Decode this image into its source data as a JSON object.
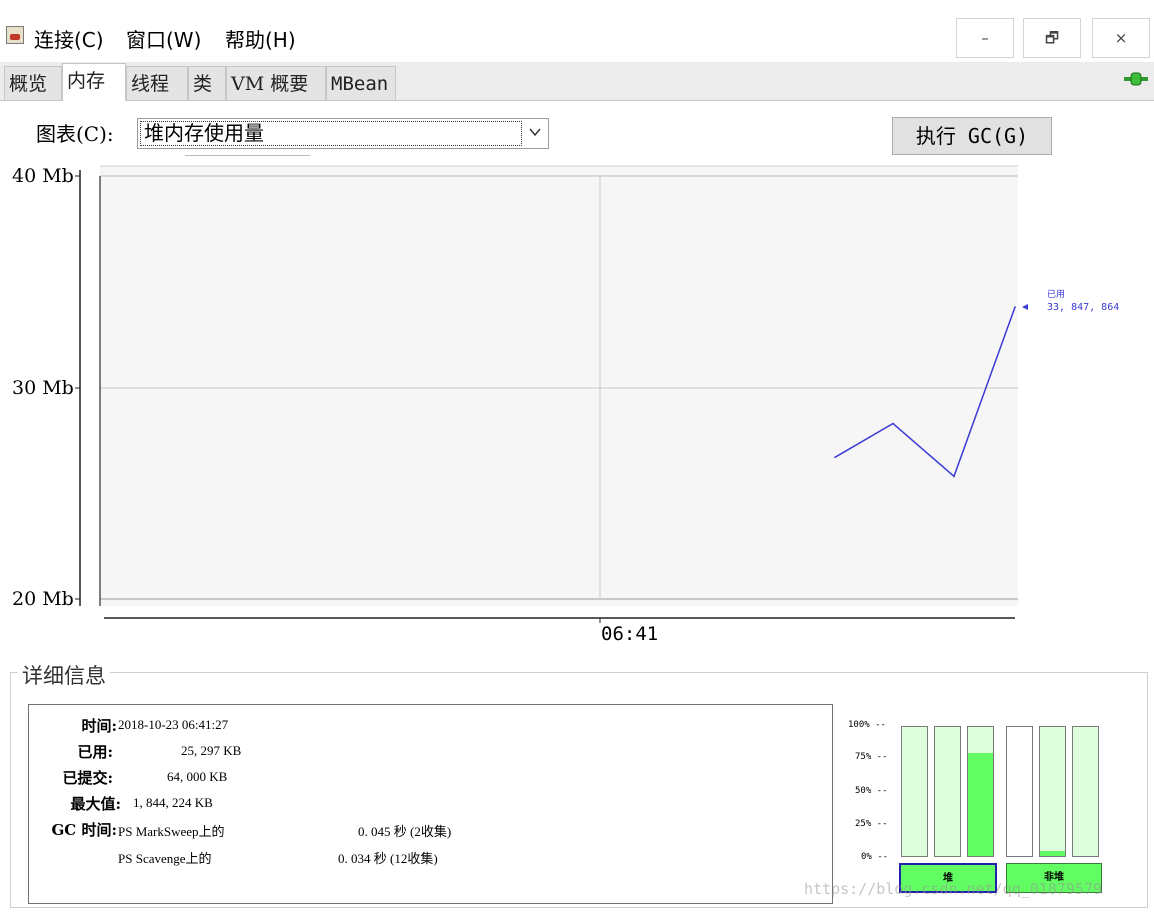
{
  "menubar": {
    "items": [
      "连接(C)",
      "窗口(W)",
      "帮助(H)"
    ]
  },
  "window_controls": {
    "minimize": "–",
    "restore": "🗗",
    "close": "×"
  },
  "tabs": [
    "概览",
    "内存",
    "线程",
    "类",
    "VM 概要",
    "MBean"
  ],
  "active_tab": "内存",
  "controls": {
    "chart_label": "图表(C):",
    "chart_select_value": "堆内存使用量",
    "gc_button": "执行 GC(G)"
  },
  "chart_data": {
    "type": "line",
    "title": "",
    "y_tick_labels": [
      "40 Mb",
      "30 Mb",
      "20 Mb"
    ],
    "y_ticks": [
      40,
      30,
      20
    ],
    "ylim": [
      20,
      40
    ],
    "x_tick_labels": [
      "06:41"
    ],
    "grid": true,
    "series": [
      {
        "name": "已用",
        "color": "#3b3bd4",
        "values": [
          26.7,
          28.3,
          25.8,
          33.8
        ]
      }
    ],
    "annotation": {
      "label": "已用",
      "value": "33, 847, 864"
    }
  },
  "details": {
    "title": "详细信息",
    "rows": [
      {
        "key": "时间:",
        "value": "2018-10-23 06:41:27"
      },
      {
        "key": "已用:",
        "value": "25, 297 KB"
      },
      {
        "key": "已提交:",
        "value": "64, 000 KB"
      },
      {
        "key": "最大值:",
        "value": "1, 844, 224 KB"
      },
      {
        "key": "GC 时间:",
        "value": "PS MarkSweep上的",
        "extra": "0. 045 秒 (2收集)"
      },
      {
        "key": "",
        "value": "PS Scavenge上的",
        "extra": "0. 034 秒 (12收集)"
      }
    ]
  },
  "gauge": {
    "axis_labels": [
      "100% --",
      "75% --",
      "50% --",
      "25% --",
      "0% --"
    ],
    "heap_bars": [
      0.0,
      0.0,
      0.8
    ],
    "nonheap_bars": [
      null,
      0.04,
      0.0
    ],
    "heap_label": "堆",
    "nonheap_label": "非堆"
  },
  "watermark": "https://blog.csdn.net/qq_01879579"
}
